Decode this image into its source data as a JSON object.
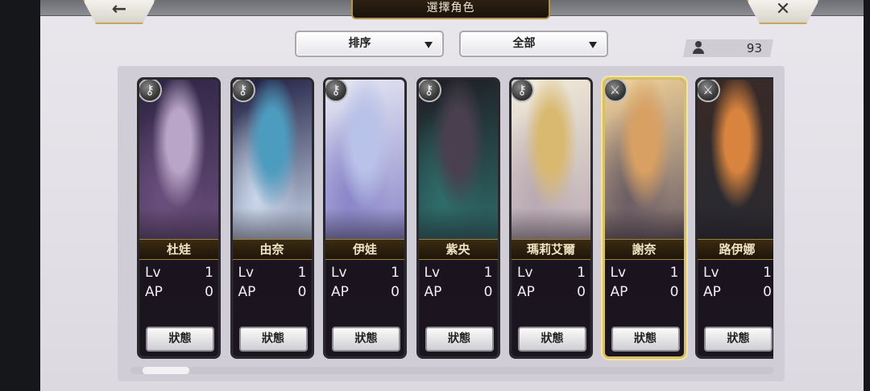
{
  "header": {
    "title": "選擇角色",
    "back_icon": "←",
    "close_icon": "✕"
  },
  "toolbar": {
    "sort_label": "排序",
    "filter_label": "全部",
    "character_count": "93"
  },
  "characters": [
    {
      "name": "杜娃",
      "lv_label": "Lv",
      "lv": "1",
      "ap_label": "AP",
      "ap": "0",
      "status_label": "狀態",
      "class_icon": "key-icon",
      "badge": "⚷",
      "colors": [
        "#2d2342",
        "#b9a5c7",
        "#6a4f7c"
      ],
      "selected": false
    },
    {
      "name": "由奈",
      "lv_label": "Lv",
      "lv": "1",
      "ap_label": "AP",
      "ap": "0",
      "status_label": "狀態",
      "class_icon": "key-icon",
      "badge": "⚷",
      "colors": [
        "#1b1a3e",
        "#4c9cc0",
        "#c9d6ea"
      ],
      "selected": false
    },
    {
      "name": "伊娃",
      "lv_label": "Lv",
      "lv": "1",
      "ap_label": "AP",
      "ap": "0",
      "status_label": "狀態",
      "class_icon": "key-icon",
      "badge": "⚷",
      "colors": [
        "#e7e9f4",
        "#b9c2e8",
        "#8a86c9"
      ],
      "selected": false
    },
    {
      "name": "紫央",
      "lv_label": "Lv",
      "lv": "1",
      "ap_label": "AP",
      "ap": "0",
      "status_label": "狀態",
      "class_icon": "key-icon",
      "badge": "⚷",
      "colors": [
        "#1e1b22",
        "#4a3f4f",
        "#2f6c6a"
      ],
      "selected": false
    },
    {
      "name": "瑪莉艾爾",
      "lv_label": "Lv",
      "lv": "1",
      "ap_label": "AP",
      "ap": "0",
      "status_label": "狀態",
      "class_icon": "key-icon",
      "badge": "⚷",
      "colors": [
        "#f3ecd9",
        "#d9b970",
        "#b9a9b3"
      ],
      "selected": false
    },
    {
      "name": "謝奈",
      "lv_label": "Lv",
      "lv": "1",
      "ap_label": "AP",
      "ap": "0",
      "status_label": "狀態",
      "class_icon": "sword-icon",
      "badge": "⚔",
      "colors": [
        "#f2d39a",
        "#d8a063",
        "#6b5d65"
      ],
      "selected": true
    },
    {
      "name": "路伊娜",
      "lv_label": "Lv",
      "lv": "1",
      "ap_label": "AP",
      "ap": "0",
      "status_label": "狀態",
      "class_icon": "sword-icon",
      "badge": "⚔",
      "colors": [
        "#3a2a26",
        "#d9843e",
        "#2a2a30"
      ],
      "selected": false
    }
  ]
}
